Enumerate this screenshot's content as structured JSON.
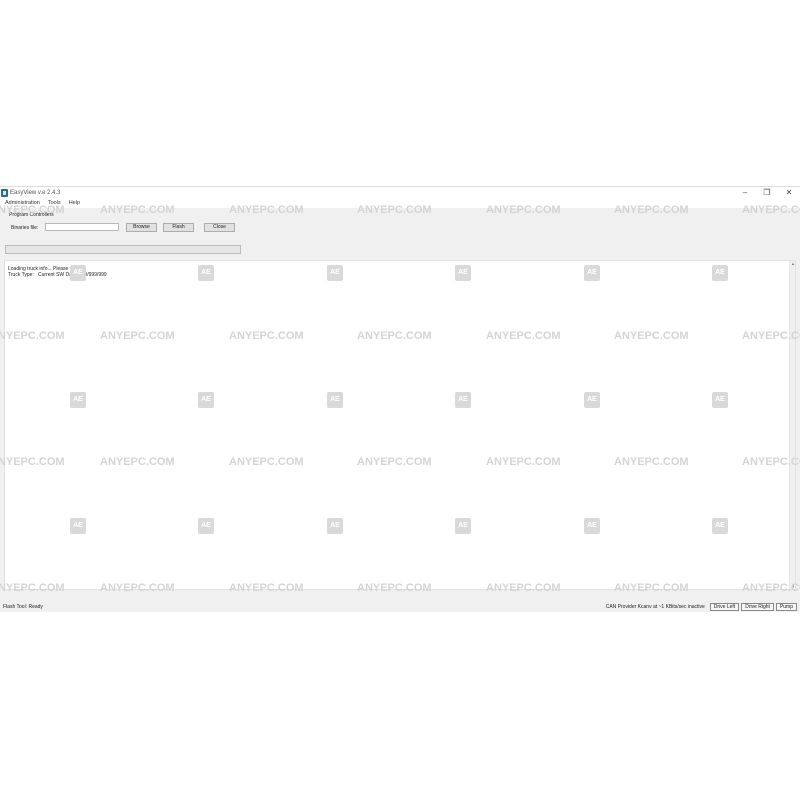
{
  "window": {
    "title": "EasyView v.e 2.4.3",
    "controls": {
      "minimize": "–",
      "maximize": "❐",
      "close": "✕"
    }
  },
  "menu": [
    "Administration",
    "Tools",
    "Help"
  ],
  "program": {
    "group_label": "Program Controllers",
    "binaries_label": "Binaries file:",
    "binaries_value": "",
    "browse_label": "Browse",
    "flash_label": "Flash",
    "close_label": "Close",
    "progress": 0
  },
  "log": [
    "Loading truck info... Please wait...",
    "Truck Type:   Current SW Date: 999/999/999"
  ],
  "status": {
    "left": "Flash Tool:  Ready",
    "provider": "CAN Provider Kcanv at ~1 KBits/sec inactive",
    "cells": [
      "Drive Left",
      "Drive Right",
      "Pump"
    ]
  },
  "watermark": {
    "text": "ANYEPC.COM",
    "badge": "AE"
  },
  "colors": {
    "window_bg": "#f0f0f0",
    "log_bg": "#ffffff",
    "watermark": "#d4d4d4"
  }
}
